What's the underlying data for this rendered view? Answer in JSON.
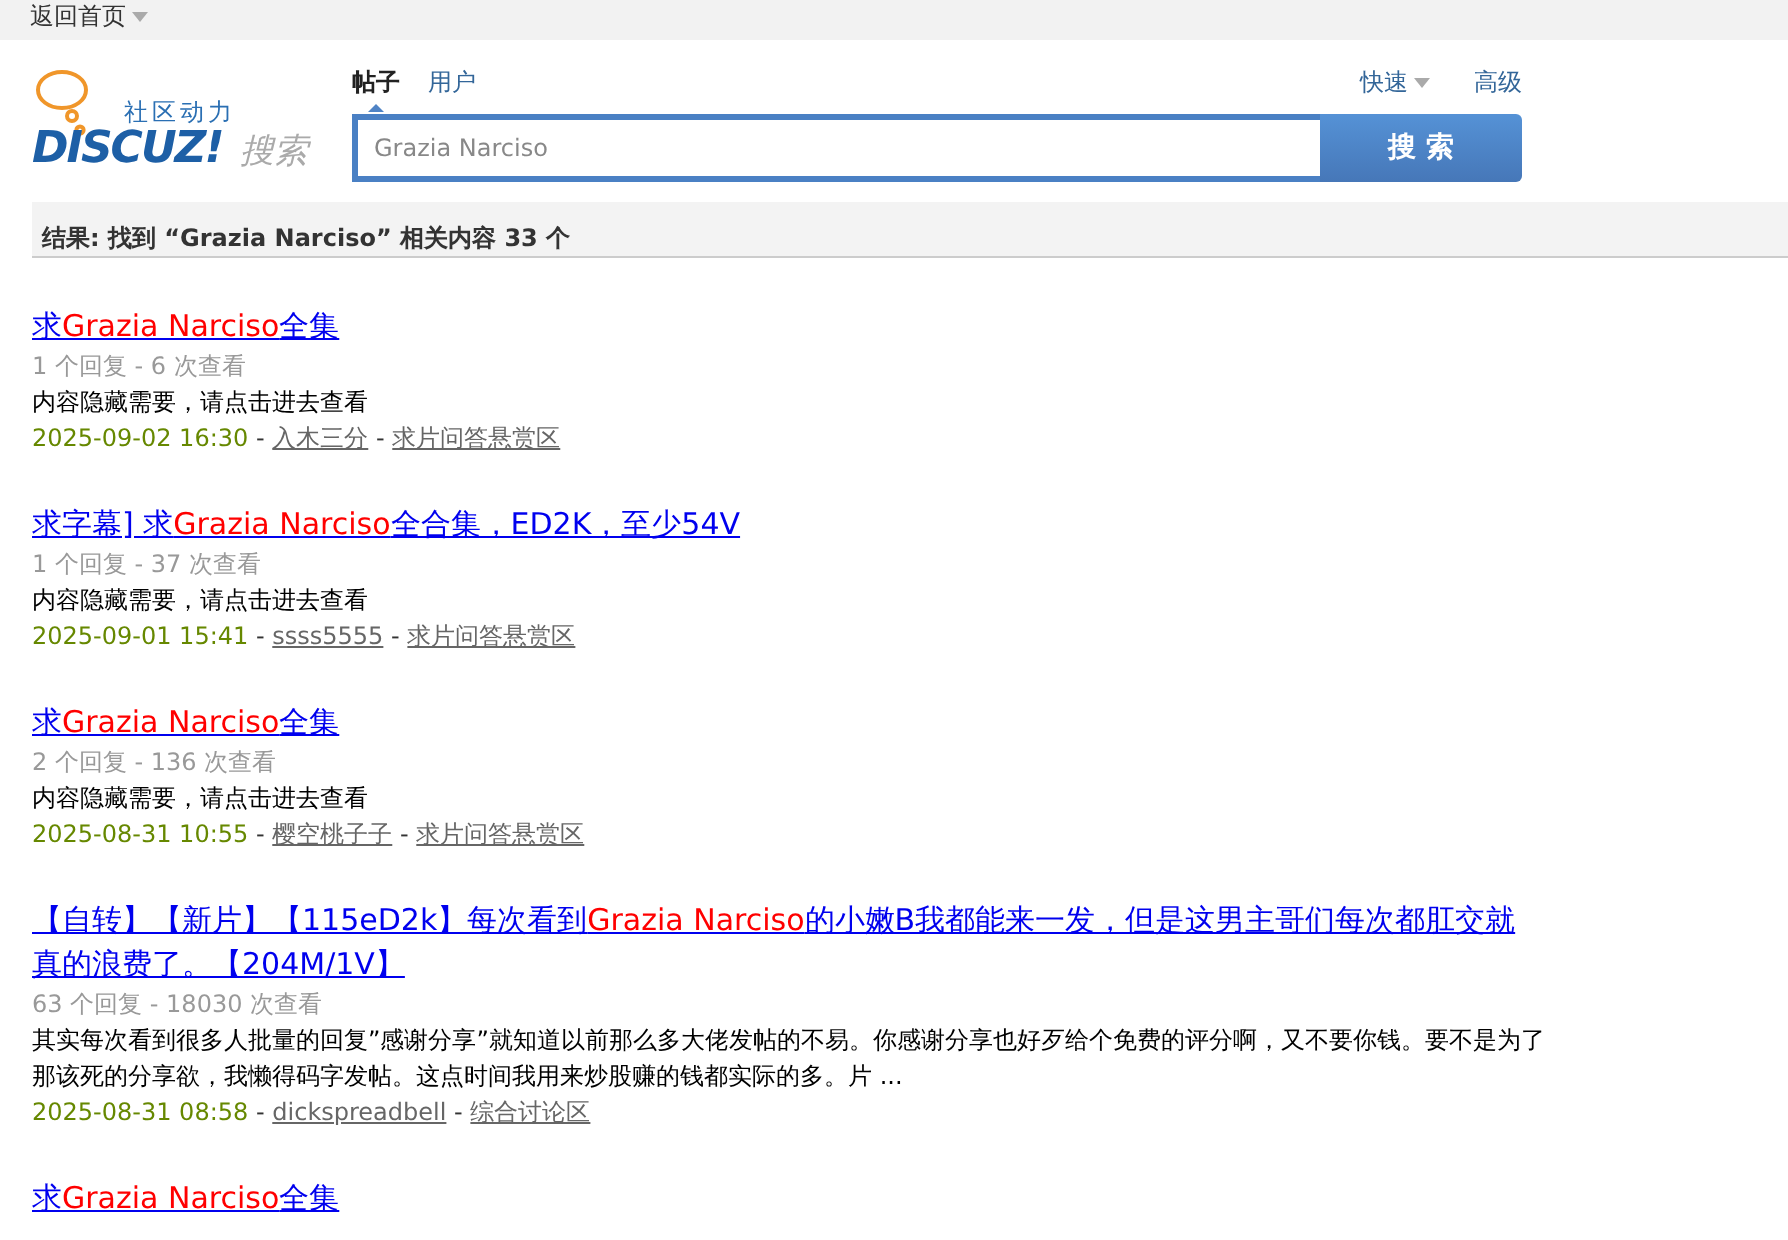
{
  "top_bar": {
    "link": "返回首页"
  },
  "logo": {
    "tagline": "社区动力",
    "name": "DISCUZ!",
    "suffix": "搜索"
  },
  "search": {
    "tabs": [
      {
        "label": "帖子",
        "selected": true
      },
      {
        "label": "用户",
        "selected": false
      }
    ],
    "quick": "快速",
    "advanced": "高级",
    "value": "Grazia Narciso",
    "button": "搜 索"
  },
  "summary": "结果: 找到 “Grazia Narciso” 相关内容 33 个",
  "results": [
    {
      "title": [
        {
          "text": "求",
          "highlight": false
        },
        {
          "text": "Grazia Narciso",
          "highlight": true
        },
        {
          "text": "全集",
          "highlight": false
        }
      ],
      "stats": "1 个回复 - 6 次查看",
      "excerpt": "内容隐藏需要，请点击进去查看",
      "date": "2025-09-02 16:30",
      "author": "入木三分",
      "separators": [
        "-",
        "-"
      ],
      "forum": "求片问答悬赏区"
    },
    {
      "title": [
        {
          "text": "求字幕] 求",
          "highlight": false
        },
        {
          "text": "Grazia Narciso",
          "highlight": true
        },
        {
          "text": "全合集，ED2K，至少54V",
          "highlight": false
        }
      ],
      "stats": "1 个回复 - 37 次查看",
      "excerpt": "内容隐藏需要，请点击进去查看",
      "date": "2025-09-01 15:41",
      "author": "ssss5555",
      "separators": [
        "-",
        "-"
      ],
      "forum": "求片问答悬赏区"
    },
    {
      "title": [
        {
          "text": "求",
          "highlight": false
        },
        {
          "text": "Grazia Narciso",
          "highlight": true
        },
        {
          "text": "全集",
          "highlight": false
        }
      ],
      "stats": "2 个回复 - 136 次查看",
      "excerpt": "内容隐藏需要，请点击进去查看",
      "date": "2025-08-31 10:55",
      "author": "樱空桃子子",
      "separators": [
        "-",
        "-"
      ],
      "forum": "求片问答悬赏区"
    },
    {
      "title": [
        {
          "text": "【自转】【新片】【115eD2k】每次看到",
          "highlight": false
        },
        {
          "text": "Grazia Narciso",
          "highlight": true
        },
        {
          "text": "的小嫩B我都能来一发，但是这男主哥们每次都肛交就真的浪费了。【204M/1V】",
          "highlight": false
        }
      ],
      "stats": "63 个回复 - 18030 次查看",
      "excerpt": "其实每次看到很多人批量的回复”感谢分享”就知道以前那么多大佬发帖的不易。你感谢分享也好歹给个免费的评分啊，又不要你钱。要不是为了那该死的分享欲，我懒得码字发帖。这点时间我用来炒股赚的钱都实际的多。片 ...",
      "date": "2025-08-31 08:58",
      "author": "dickspreadbell",
      "separators": [
        "-",
        "-"
      ],
      "forum": "综合讨论区"
    },
    {
      "title": [
        {
          "text": "求",
          "highlight": false
        },
        {
          "text": "Grazia Narciso",
          "highlight": true
        },
        {
          "text": "全集",
          "highlight": false
        }
      ]
    }
  ]
}
